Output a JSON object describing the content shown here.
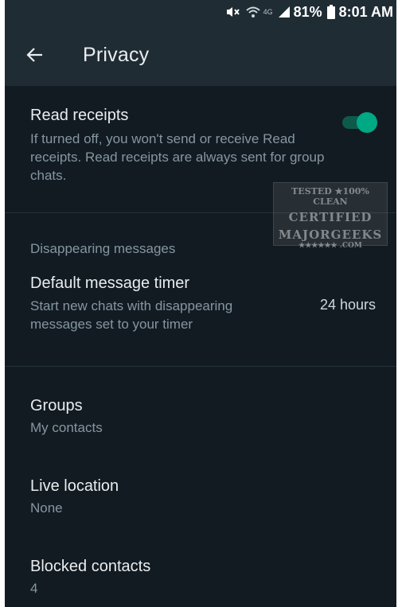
{
  "status_bar": {
    "network": "4G",
    "battery": "81%",
    "time": "8:01 AM"
  },
  "header": {
    "title": "Privacy"
  },
  "read_receipts": {
    "title": "Read receipts",
    "description": "If turned off, you won't send or receive Read receipts. Read receipts are always sent for group chats.",
    "enabled": true
  },
  "disappearing": {
    "section_label": "Disappearing messages",
    "title": "Default message timer",
    "description": "Start new chats with disappearing messages set to your timer",
    "value": "24 hours"
  },
  "groups": {
    "title": "Groups",
    "value": "My contacts"
  },
  "live_location": {
    "title": "Live location",
    "value": "None"
  },
  "blocked_contacts": {
    "title": "Blocked contacts",
    "value": "4"
  },
  "watermark": {
    "line1": "TESTED ★100% CLEAN",
    "line2": "CERTIFIED",
    "line3": "MAJORGEEKS",
    "line4": "★★★★★★ .COM"
  },
  "colors": {
    "background": "#121b22",
    "appbar": "#1f2c34",
    "accent": "#00a884",
    "text_primary": "#e9edef",
    "text_secondary": "#8696a0"
  },
  "icons": [
    "mute-icon",
    "wifi-icon",
    "signal-icon",
    "battery-icon",
    "back-arrow-icon"
  ]
}
